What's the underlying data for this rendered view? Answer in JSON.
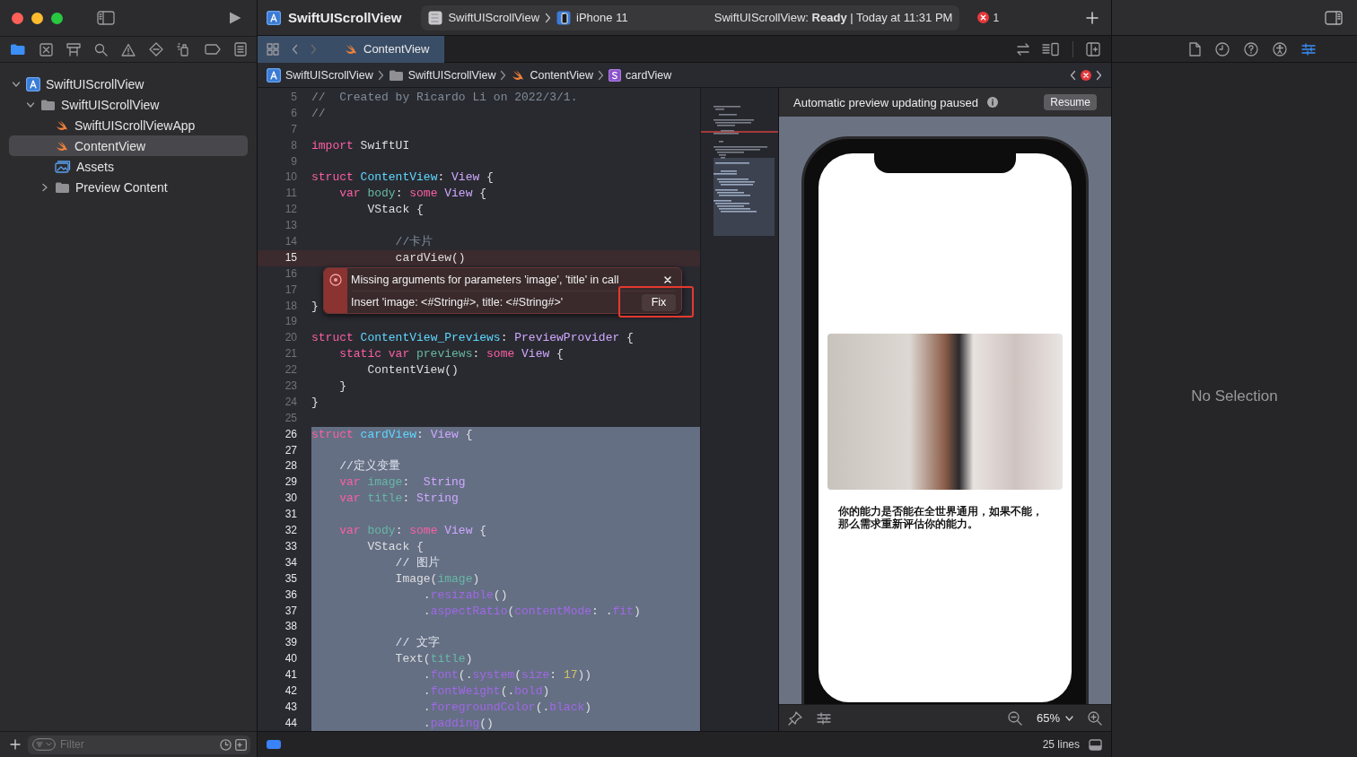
{
  "toolbar": {
    "project_title": "SwiftUIScrollView",
    "scheme": "SwiftUIScrollView",
    "device": "iPhone 11",
    "status": "SwiftUIScrollView: **Ready** | Today at 11:31 PM",
    "error_count": "1"
  },
  "navigator": {
    "items": [
      {
        "label": "SwiftUIScrollView",
        "kind": "project",
        "expanded": true,
        "selected": false,
        "children": [
          {
            "label": "SwiftUIScrollView",
            "kind": "folder",
            "expanded": true,
            "selected": false,
            "children": [
              {
                "label": "SwiftUIScrollViewApp",
                "kind": "swift",
                "selected": false
              },
              {
                "label": "ContentView",
                "kind": "swift",
                "selected": true
              },
              {
                "label": "Assets",
                "kind": "assets",
                "selected": false
              },
              {
                "label": "Preview Content",
                "kind": "folder",
                "expanded": false,
                "selected": false
              }
            ]
          }
        ]
      }
    ],
    "filter_placeholder": "Filter"
  },
  "editor": {
    "tabs": [
      {
        "label": "ContentView",
        "kind": "swift",
        "selected": true
      }
    ],
    "breadcrumb": [
      {
        "label": "SwiftUIScrollView",
        "kind": "project"
      },
      {
        "label": "SwiftUIScrollView",
        "kind": "folder"
      },
      {
        "label": "ContentView",
        "kind": "swift"
      },
      {
        "label": "cardView",
        "kind": "struct"
      }
    ],
    "lines": [
      {
        "number": "5",
        "selected": false,
        "error": false,
        "tokens": [
          {
            "kind": "comment",
            "text": "//  Created by Ricardo Li on 2022/3/1."
          }
        ]
      },
      {
        "number": "6",
        "selected": false,
        "error": false,
        "tokens": [
          {
            "kind": "comment",
            "text": "//"
          }
        ]
      },
      {
        "number": "7",
        "selected": false,
        "error": false
      },
      {
        "number": "8",
        "selected": false,
        "error": false,
        "tokens": [
          {
            "kind": "keyword",
            "text": "import"
          },
          {
            "kind": "plain",
            "text": " SwiftUI"
          }
        ]
      },
      {
        "number": "9",
        "selected": false,
        "error": false
      },
      {
        "number": "10",
        "selected": false,
        "error": false,
        "tokens": [
          {
            "kind": "keyword",
            "text": "struct"
          },
          {
            "kind": "declaration",
            "text": " ContentView"
          },
          {
            "kind": "plain",
            "text": ": "
          },
          {
            "kind": "type",
            "text": "View"
          },
          {
            "kind": "plain",
            "text": " {"
          }
        ]
      },
      {
        "number": "11",
        "selected": false,
        "error": false,
        "tokens": [
          {
            "kind": "keyword",
            "text": "    var"
          },
          {
            "kind": "property",
            "text": " body"
          },
          {
            "kind": "plain",
            "text": ": "
          },
          {
            "kind": "keyword",
            "text": "some"
          },
          {
            "kind": "type",
            "text": " View"
          },
          {
            "kind": "plain",
            "text": " {"
          }
        ]
      },
      {
        "number": "12",
        "selected": false,
        "error": false,
        "tokens": [
          {
            "kind": "plain",
            "text": "        VStack {"
          }
        ]
      },
      {
        "number": "13",
        "selected": false,
        "error": false
      },
      {
        "number": "14",
        "selected": false,
        "error": false,
        "tokens": [
          {
            "kind": "comment",
            "text": "            //卡片"
          }
        ]
      },
      {
        "number": "15",
        "selected": false,
        "error": true,
        "tokens": [
          {
            "kind": "plain",
            "text": "            cardView()"
          }
        ]
      },
      {
        "number": "16",
        "selected": false,
        "error": false
      },
      {
        "number": "17",
        "selected": false,
        "error": false
      },
      {
        "number": "18",
        "selected": false,
        "error": false,
        "tokens": [
          {
            "kind": "plain",
            "text": "}"
          }
        ]
      },
      {
        "number": "19",
        "selected": false,
        "error": false
      },
      {
        "number": "20",
        "selected": false,
        "error": false,
        "tokens": [
          {
            "kind": "keyword",
            "text": "struct"
          },
          {
            "kind": "declaration",
            "text": " ContentView_Previews"
          },
          {
            "kind": "plain",
            "text": ": "
          },
          {
            "kind": "type",
            "text": "PreviewProvider"
          },
          {
            "kind": "plain",
            "text": " {"
          }
        ]
      },
      {
        "number": "21",
        "selected": false,
        "error": false,
        "tokens": [
          {
            "kind": "keyword",
            "text": "    static var"
          },
          {
            "kind": "property",
            "text": " previews"
          },
          {
            "kind": "plain",
            "text": ": "
          },
          {
            "kind": "keyword",
            "text": "some"
          },
          {
            "kind": "type",
            "text": " View"
          },
          {
            "kind": "plain",
            "text": " {"
          }
        ]
      },
      {
        "number": "22",
        "selected": false,
        "error": false,
        "tokens": [
          {
            "kind": "plain",
            "text": "        ContentView()"
          }
        ]
      },
      {
        "number": "23",
        "selected": false,
        "error": false,
        "tokens": [
          {
            "kind": "plain",
            "text": "    }"
          }
        ]
      },
      {
        "number": "24",
        "selected": false,
        "error": false,
        "tokens": [
          {
            "kind": "plain",
            "text": "}"
          }
        ]
      },
      {
        "number": "25",
        "selected": false,
        "error": false
      },
      {
        "number": "26",
        "selected": true,
        "error": false,
        "tokens": [
          {
            "kind": "keyword",
            "text": "struct"
          },
          {
            "kind": "declaration",
            "text": " cardView"
          },
          {
            "kind": "plain",
            "text": ": "
          },
          {
            "kind": "type",
            "text": "View"
          },
          {
            "kind": "plain",
            "text": " {"
          }
        ]
      },
      {
        "number": "27",
        "selected": true,
        "error": false
      },
      {
        "number": "28",
        "selected": true,
        "error": false,
        "tokens": [
          {
            "kind": "comment",
            "text": "    //定义变量"
          }
        ]
      },
      {
        "number": "29",
        "selected": true,
        "error": false,
        "tokens": [
          {
            "kind": "keyword",
            "text": "    var"
          },
          {
            "kind": "property",
            "text": " image"
          },
          {
            "kind": "plain",
            "text": ":"
          },
          {
            "kind": "type",
            "text": "  String"
          }
        ]
      },
      {
        "number": "30",
        "selected": true,
        "error": false,
        "tokens": [
          {
            "kind": "keyword",
            "text": "    var"
          },
          {
            "kind": "property",
            "text": " title"
          },
          {
            "kind": "plain",
            "text": ":"
          },
          {
            "kind": "type",
            "text": " String"
          }
        ]
      },
      {
        "number": "31",
        "selected": true,
        "error": false
      },
      {
        "number": "32",
        "selected": true,
        "error": false,
        "tokens": [
          {
            "kind": "keyword",
            "text": "    var"
          },
          {
            "kind": "property",
            "text": " body"
          },
          {
            "kind": "plain",
            "text": ": "
          },
          {
            "kind": "keyword",
            "text": "some"
          },
          {
            "kind": "type",
            "text": " View"
          },
          {
            "kind": "plain",
            "text": " {"
          }
        ]
      },
      {
        "number": "33",
        "selected": true,
        "error": false,
        "tokens": [
          {
            "kind": "plain",
            "text": "        VStack {"
          }
        ]
      },
      {
        "number": "34",
        "selected": true,
        "error": false,
        "tokens": [
          {
            "kind": "comment",
            "text": "            // 图片"
          }
        ]
      },
      {
        "number": "35",
        "selected": true,
        "error": false,
        "tokens": [
          {
            "kind": "plain",
            "text": "            Image("
          },
          {
            "kind": "property",
            "text": "image"
          },
          {
            "kind": "plain",
            "text": ")"
          }
        ]
      },
      {
        "number": "36",
        "selected": true,
        "error": false,
        "tokens": [
          {
            "kind": "plain",
            "text": "                ."
          },
          {
            "kind": "method",
            "text": "resizable"
          },
          {
            "kind": "plain",
            "text": "()"
          }
        ]
      },
      {
        "number": "37",
        "selected": true,
        "error": false,
        "tokens": [
          {
            "kind": "plain",
            "text": "                ."
          },
          {
            "kind": "method",
            "text": "aspectRatio"
          },
          {
            "kind": "plain",
            "text": "("
          },
          {
            "kind": "method",
            "text": "contentMode"
          },
          {
            "kind": "plain",
            "text": ": ."
          },
          {
            "kind": "method",
            "text": "fit"
          },
          {
            "kind": "plain",
            "text": ")"
          }
        ]
      },
      {
        "number": "38",
        "selected": true,
        "error": false
      },
      {
        "number": "39",
        "selected": true,
        "error": false,
        "tokens": [
          {
            "kind": "comment",
            "text": "            // 文字"
          }
        ]
      },
      {
        "number": "40",
        "selected": true,
        "error": false,
        "tokens": [
          {
            "kind": "plain",
            "text": "            Text("
          },
          {
            "kind": "property",
            "text": "title"
          },
          {
            "kind": "plain",
            "text": ")"
          }
        ]
      },
      {
        "number": "41",
        "selected": true,
        "error": false,
        "tokens": [
          {
            "kind": "plain",
            "text": "                ."
          },
          {
            "kind": "method",
            "text": "font"
          },
          {
            "kind": "plain",
            "text": "(."
          },
          {
            "kind": "method",
            "text": "system"
          },
          {
            "kind": "plain",
            "text": "("
          },
          {
            "kind": "method",
            "text": "size"
          },
          {
            "kind": "plain",
            "text": ":"
          },
          {
            "kind": "number",
            "text": " 17"
          },
          {
            "kind": "plain",
            "text": "))"
          }
        ]
      },
      {
        "number": "42",
        "selected": true,
        "error": false,
        "tokens": [
          {
            "kind": "plain",
            "text": "                ."
          },
          {
            "kind": "method",
            "text": "fontWeight"
          },
          {
            "kind": "plain",
            "text": "(."
          },
          {
            "kind": "method",
            "text": "bold"
          },
          {
            "kind": "plain",
            "text": ")"
          }
        ]
      },
      {
        "number": "43",
        "selected": true,
        "error": false,
        "tokens": [
          {
            "kind": "plain",
            "text": "                ."
          },
          {
            "kind": "method",
            "text": "foregroundColor"
          },
          {
            "kind": "plain",
            "text": "(."
          },
          {
            "kind": "method",
            "text": "black"
          },
          {
            "kind": "plain",
            "text": ")"
          }
        ]
      },
      {
        "number": "44",
        "selected": true,
        "error": false,
        "tokens": [
          {
            "kind": "plain",
            "text": "                ."
          },
          {
            "kind": "method",
            "text": "padding"
          },
          {
            "kind": "plain",
            "text": "()"
          }
        ]
      }
    ],
    "issue": {
      "message": "Missing arguments for parameters 'image', 'title' in call",
      "fix_description": "Insert 'image: <#String#>, title: <#String#>'",
      "fix_button": "Fix"
    },
    "line_count": "25 lines"
  },
  "preview": {
    "banner": "Automatic preview updating paused",
    "resume_button": "Resume",
    "card_text": "你的能力是否能在全世界通用，如果不能，那么需求重新评估你的能力。",
    "zoom": "65%"
  },
  "inspector": {
    "placeholder": "No Selection"
  }
}
